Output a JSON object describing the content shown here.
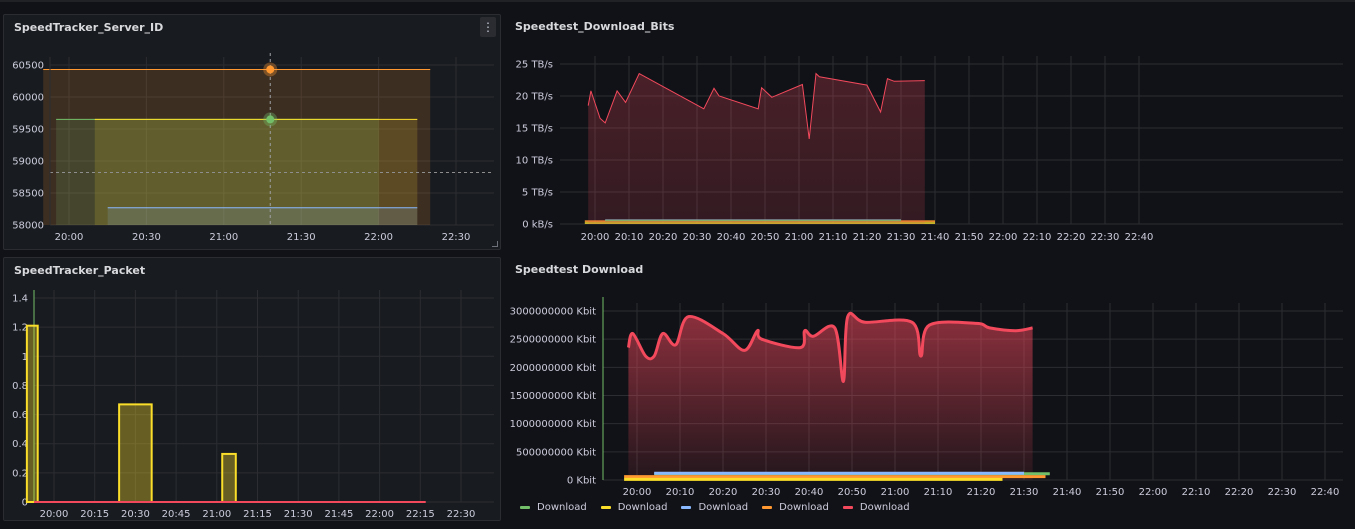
{
  "colors": {
    "green": "#73bf69",
    "yellow": "#fade2a",
    "blue": "#8ab8ff",
    "orange": "#ff9830",
    "red": "#f2495c",
    "grid": "#2b2d32",
    "axis_text": "#ccccdc",
    "background": "#111217",
    "panel_bg": "#181b1f"
  },
  "panels": {
    "server_id": {
      "title": "SpeedTracker_Server_ID",
      "menu_icon": "⋮"
    },
    "download_bits": {
      "title": "Speedtest_Download_Bits"
    },
    "packet": {
      "title": "SpeedTracker_Packet"
    },
    "download": {
      "title": "Speedtest Download"
    }
  },
  "legend": {
    "items": [
      {
        "label": "Download",
        "color": "#73bf69"
      },
      {
        "label": "Download",
        "color": "#fade2a"
      },
      {
        "label": "Download",
        "color": "#8ab8ff"
      },
      {
        "label": "Download",
        "color": "#ff9830"
      },
      {
        "label": "Download",
        "color": "#f2495c"
      }
    ]
  },
  "chart_data": [
    {
      "id": "server_id",
      "type": "area",
      "title": "SpeedTracker_Server_ID",
      "x_ticks": [
        "20:00",
        "20:30",
        "21:00",
        "21:30",
        "22:00",
        "22:30"
      ],
      "y_ticks": [
        "58000",
        "58500",
        "59000",
        "59500",
        "60000",
        "60500"
      ],
      "ylim": [
        58000,
        60500
      ],
      "xlim_minutes": [
        -15,
        45
      ],
      "grid": true,
      "hover_time_minute": 78,
      "threshold_value": 58820,
      "series": [
        {
          "color": "#ff9830",
          "points": [
            [
              -10,
              60430
            ],
            [
              140,
              60430
            ]
          ],
          "marker": 60430
        },
        {
          "color": "#73bf69",
          "points": [
            [
              -5,
              59650
            ],
            [
              120,
              59650
            ]
          ],
          "marker": 59650
        },
        {
          "color": "#fade2a",
          "points": [
            [
              10,
              59650
            ],
            [
              135,
              59650
            ]
          ]
        },
        {
          "color": "#8ab8ff",
          "points": [
            [
              15,
              58270
            ],
            [
              135,
              58270
            ]
          ]
        }
      ]
    },
    {
      "id": "download_bits",
      "type": "area",
      "title": "Speedtest_Download_Bits",
      "x_ticks": [
        "20:00",
        "20:10",
        "20:20",
        "20:30",
        "20:40",
        "20:50",
        "21:00",
        "21:10",
        "21:20",
        "21:30",
        "21:40",
        "21:50",
        "22:00",
        "22:10",
        "22:20",
        "22:30",
        "22:40"
      ],
      "y_ticks": [
        "0 kB/s",
        "5 TB/s",
        "10 TB/s",
        "15 TB/s",
        "20 TB/s",
        "25 TB/s"
      ],
      "ylim": [
        0,
        25
      ],
      "grid": true,
      "series": [
        {
          "color": "#f2495c",
          "points": [
            [
              -2,
              18.5
            ],
            [
              -1.2,
              20.8
            ],
            [
              1.5,
              16.5
            ],
            [
              3,
              15.8
            ],
            [
              6.5,
              20.8
            ],
            [
              9,
              19.0
            ],
            [
              13,
              23.5
            ],
            [
              32,
              18.0
            ],
            [
              35,
              21.2
            ],
            [
              36.5,
              20.0
            ],
            [
              48,
              18.0
            ],
            [
              49,
              21.3
            ],
            [
              52,
              19.8
            ],
            [
              61,
              21.8
            ],
            [
              63,
              13.3
            ],
            [
              65,
              23.5
            ],
            [
              66,
              23.0
            ],
            [
              80,
              21.7
            ],
            [
              84,
              17.5
            ],
            [
              86,
              22.7
            ],
            [
              88,
              22.3
            ],
            [
              97,
              22.4
            ]
          ]
        },
        {
          "color": "#ff9830",
          "points": [
            [
              -3,
              0.45
            ],
            [
              100,
              0.45
            ]
          ]
        },
        {
          "color": "#fade2a",
          "points": [
            [
              -3,
              0.15
            ],
            [
              100,
              0.15
            ]
          ]
        },
        {
          "color": "#8ab8ff",
          "points": [
            [
              3,
              0.6
            ],
            [
              90,
              0.6
            ]
          ]
        },
        {
          "color": "#73bf69",
          "points": [
            [
              3,
              0.55
            ],
            [
              90,
              0.55
            ]
          ]
        }
      ]
    },
    {
      "id": "packet",
      "type": "bar",
      "title": "SpeedTracker_Packet",
      "x_ticks": [
        "20:00",
        "20:15",
        "20:30",
        "20:45",
        "21:00",
        "21:15",
        "21:30",
        "21:45",
        "22:00",
        "22:15",
        "22:30"
      ],
      "y_ticks": [
        "0",
        "0.2",
        "0.4",
        "0.6",
        "0.8",
        "1",
        "1.2",
        "1.4"
      ],
      "ylim": [
        0,
        1.4
      ],
      "grid": true,
      "bars": [
        {
          "start_min": -10,
          "end_min": -6,
          "value": 1.21
        },
        {
          "start_min": 24,
          "end_min": 36,
          "value": 0.67
        },
        {
          "start_min": 62,
          "end_min": 67,
          "value": 0.33
        }
      ],
      "baseline_series_end_min": 137
    },
    {
      "id": "download",
      "type": "area",
      "title": "Speedtest Download",
      "x_ticks": [
        "20:00",
        "20:10",
        "20:20",
        "20:30",
        "20:40",
        "20:50",
        "21:00",
        "21:10",
        "21:20",
        "21:30",
        "21:40",
        "21:50",
        "22:00",
        "22:10",
        "22:20",
        "22:30",
        "22:40"
      ],
      "y_ticks": [
        "0 Kbit",
        "500000000 Kbit",
        "1000000000 Kbit",
        "1500000000 Kbit",
        "2000000000 Kbit",
        "2500000000 Kbit",
        "3000000000 Kbit"
      ],
      "ylim": [
        0,
        3000000000
      ],
      "grid": true,
      "series_label": "Download",
      "series": [
        {
          "color": "#f2495c",
          "points": [
            [
              -2,
              2350000000
            ],
            [
              -1,
              2600000000
            ],
            [
              2,
              2200000000
            ],
            [
              4,
              2200000000
            ],
            [
              6,
              2600000000
            ],
            [
              9,
              2400000000
            ],
            [
              12,
              2900000000
            ],
            [
              20,
              2600000000
            ],
            [
              25,
              2300000000
            ],
            [
              28,
              2650000000
            ],
            [
              29,
              2500000000
            ],
            [
              38,
              2350000000
            ],
            [
              39,
              2650000000
            ],
            [
              41,
              2550000000
            ],
            [
              46,
              2700000000
            ],
            [
              48,
              1750000000
            ],
            [
              49,
              2900000000
            ],
            [
              53,
              2800000000
            ],
            [
              64,
              2800000000
            ],
            [
              66,
              2200000000
            ],
            [
              68,
              2750000000
            ],
            [
              79,
              2780000000
            ],
            [
              82,
              2700000000
            ],
            [
              88,
              2650000000
            ],
            [
              92,
              2700000000
            ]
          ]
        },
        {
          "color": "#73bf69",
          "points": [
            [
              4,
              110000000
            ],
            [
              96,
              110000000
            ]
          ]
        },
        {
          "color": "#8ab8ff",
          "points": [
            [
              4,
              120000000
            ],
            [
              90,
              120000000
            ]
          ]
        },
        {
          "color": "#ff9830",
          "points": [
            [
              -3,
              60000000
            ],
            [
              95,
              60000000
            ]
          ]
        },
        {
          "color": "#fade2a",
          "points": [
            [
              -3,
              10000000
            ],
            [
              85,
              10000000
            ]
          ]
        }
      ]
    }
  ]
}
